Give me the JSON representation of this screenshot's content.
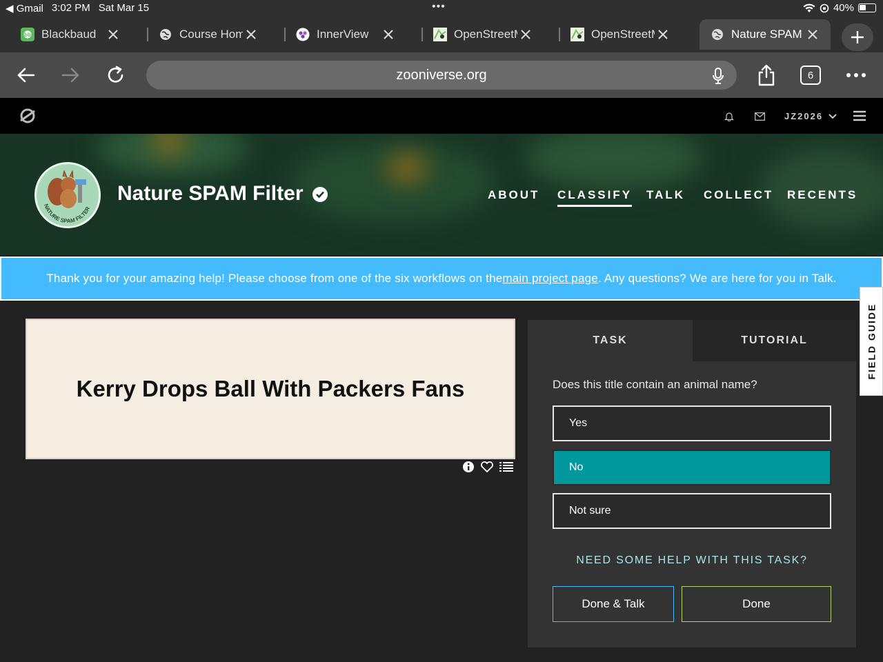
{
  "status_bar": {
    "back_app": "Gmail",
    "time": "3:02 PM",
    "date": "Sat Mar 15",
    "battery": "40%"
  },
  "browser_tabs": [
    {
      "title": "Blackbaud",
      "icon": "blackbaud-icon"
    },
    {
      "title": "Course Home",
      "icon": "globe-icon"
    },
    {
      "title": "InnerView",
      "icon": "innerview-icon"
    },
    {
      "title": "OpenStreetM",
      "icon": "openstreetmap-icon"
    },
    {
      "title": "OpenStreetM",
      "icon": "openstreetmap-icon"
    },
    {
      "title": "Nature SPAM",
      "icon": "globe-icon",
      "active": true
    }
  ],
  "toolbar": {
    "url": "zooniverse.org",
    "tab_count": "6"
  },
  "zooniverse_nav": {
    "username": "JZ2026"
  },
  "project": {
    "title": "Nature SPAM Filter",
    "avatar_text": "NATURE SPAM FILTER",
    "nav": [
      "ABOUT",
      "CLASSIFY",
      "TALK",
      "COLLECT",
      "RECENTS"
    ],
    "active_nav": "CLASSIFY"
  },
  "banner": {
    "before": "Thank you for your amazing help! Please choose from one of the six workflows on the ",
    "link": "main project page",
    "after": ". Any questions? We are here for you in Talk."
  },
  "subject": {
    "text": "Kerry Drops Ball With Packers Fans"
  },
  "task_panel": {
    "tabs": [
      "TASK",
      "TUTORIAL"
    ],
    "question": "Does this title contain an animal name?",
    "answers": [
      "Yes",
      "No",
      "Not sure"
    ],
    "selected_answer": "No",
    "help_link": "NEED SOME HELP WITH THIS TASK?",
    "done_talk": "Done & Talk",
    "done": "Done"
  },
  "field_guide": "FIELD GUIDE",
  "colors": {
    "banner": "#43bbfd",
    "selected_answer": "#00979d",
    "done_talk_border": "#43bbfd",
    "done_border": "#b7d26a"
  }
}
